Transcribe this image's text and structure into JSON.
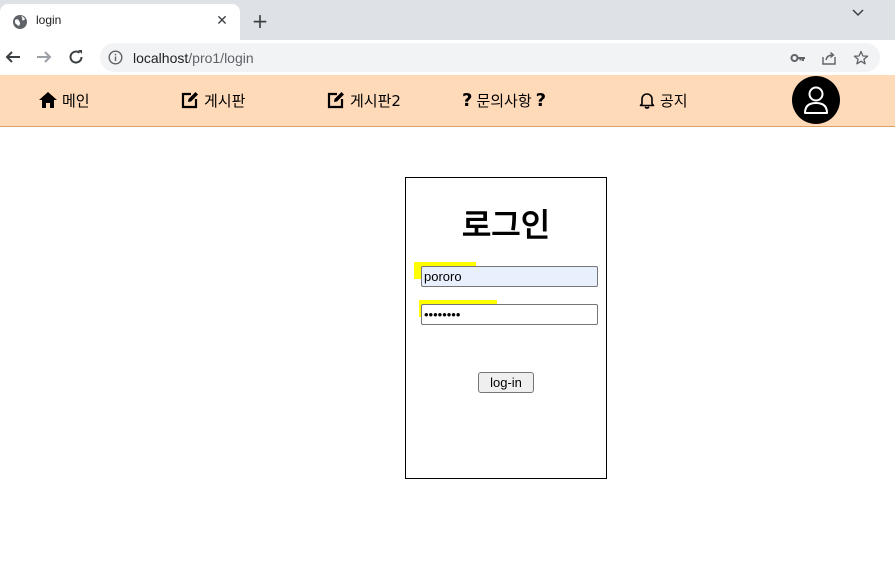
{
  "browser": {
    "tab_title": "login",
    "url_host": "localhost",
    "url_path": "/pro1/login"
  },
  "sitenav": {
    "items": [
      {
        "label": "메인",
        "icon": "home-icon"
      },
      {
        "label": "게시판",
        "icon": "edit-icon"
      },
      {
        "label": "게시판2",
        "icon": "edit-icon"
      },
      {
        "label": "문의사항",
        "icon": "question-icon",
        "suffix": "?"
      },
      {
        "label": "공지",
        "icon": "bell-icon"
      }
    ],
    "prefix_q": "?",
    "avatar_icon": "user-icon"
  },
  "login": {
    "title": "로그인",
    "id_value": "pororo",
    "pw_value": "pororo12",
    "button_label": "log-in"
  },
  "colors": {
    "navbar_bg": "#ffdab9",
    "highlight": "#ffff00",
    "avatar_bg": "#000000"
  }
}
